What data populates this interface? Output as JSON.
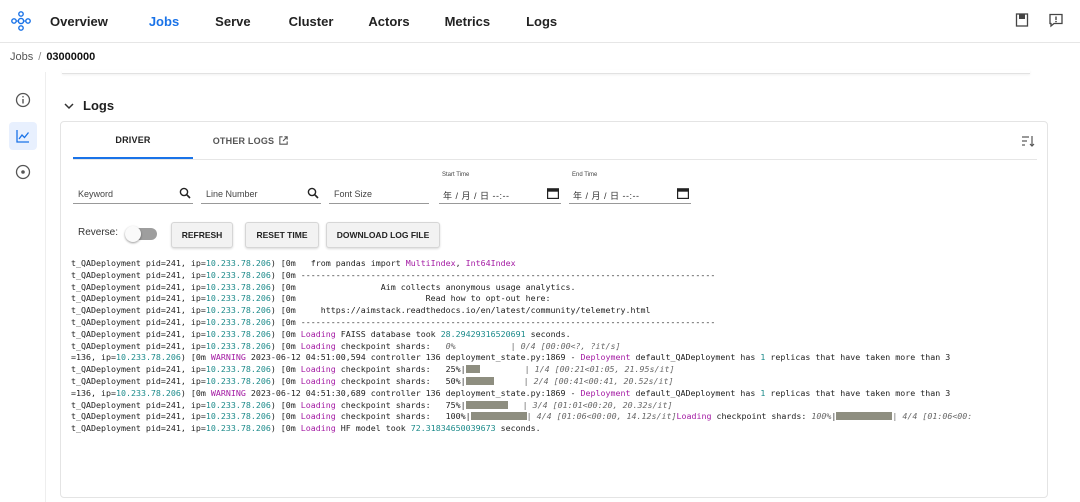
{
  "nav": {
    "items": [
      {
        "label": "Overview",
        "active": false
      },
      {
        "label": "Jobs",
        "active": true
      },
      {
        "label": "Serve",
        "active": false
      },
      {
        "label": "Cluster",
        "active": false
      },
      {
        "label": "Actors",
        "active": false
      },
      {
        "label": "Metrics",
        "active": false
      },
      {
        "label": "Logs",
        "active": false
      }
    ]
  },
  "breadcrumb": {
    "root": "Jobs",
    "sep": "/",
    "current": "03000000"
  },
  "section": {
    "title": "Logs"
  },
  "tabs": {
    "driver": "DRIVER",
    "other": "OTHER LOGS"
  },
  "filters": {
    "keyword": "Keyword",
    "line_number": "Line Number",
    "font_size": "Font Size",
    "start_time_label": "Start Time",
    "end_time_label": "End Time",
    "date_placeholder": "年 / 月 / 日  --:--"
  },
  "controls": {
    "reverse_label": "Reverse:",
    "refresh": "REFRESH",
    "reset_time": "RESET TIME",
    "download": "DOWNLOAD LOG FILE"
  },
  "log": {
    "p": "t_QADeployment pid=241, ip=",
    "ip": "10.233.78.206",
    "close": ")",
    "esc": " [0m",
    "p2": "=136, ip=",
    "ip2": "10.233.78.206",
    "l1": "   from pandas import ",
    "l1a": "MultiIndex",
    "l1b": ", ",
    "l1c": "Int64Index",
    "l2": " -----------------------------------------------------------------------------------",
    "l3": "                 Aim collects anonymous usage analytics.",
    "l4": "                          Read how to opt-out here:",
    "l5": "     https://aimstack.readthedocs.io/en/latest/community/telemetry.html",
    "l6": " -----------------------------------------------------------------------------------",
    "l7a": " Loading ",
    "l7b": "FAISS",
    "l7c": " database took ",
    "l7d": "28.29429316520691",
    "l7e": " seconds.",
    "ld_a": " Loading",
    "ld_b": " checkpoint shards:   ",
    "p0": "0%",
    "p0_tail": "           | 0/4 [00:00<?, ?it/s]",
    "w_a": "[0m ",
    "w_b": "WARNING",
    "w_c": " 2023-06-12 04:51:00,594 controller 136 deployment_state.py:1869 - ",
    "w_d": "Deployment",
    "w_e": " default_QADeployment has ",
    "w_f": "1",
    "w_g": " replicas that have taken more than 3",
    "p25": "25%",
    "p25_tail": "| 1/4 [00:21<01:05, 21.95s/it]",
    "p50": "50%",
    "p50_tail": "| 2/4 [00:41<00:41, 20.52s/it]",
    "w2_c": " 2023-06-12 04:51:30,689 controller 136 deployment_state.py:1869 - ",
    "p75": "75%",
    "p75_tail": "| 3/4 [01:01<00:20, 20.32s/it]",
    "p100": "100%",
    "p100_tail": "| 4/4 [01:06<00:00, 14.12s/it]",
    "p100_b": "Loading",
    "p100_c": " checkpoint shards: ",
    "p100_d": "100%",
    "p100_e": "| 4/4 [01:06<00:",
    "l_hf_a": " Loading ",
    "l_hf_b": "HF",
    "l_hf_c": " model took ",
    "l_hf_d": "72.31834650039673",
    "l_hf_e": " seconds."
  },
  "colors": {
    "accent": "#1a73e8",
    "ip": "#1b8a8a",
    "keyword": "#a31aa3"
  }
}
